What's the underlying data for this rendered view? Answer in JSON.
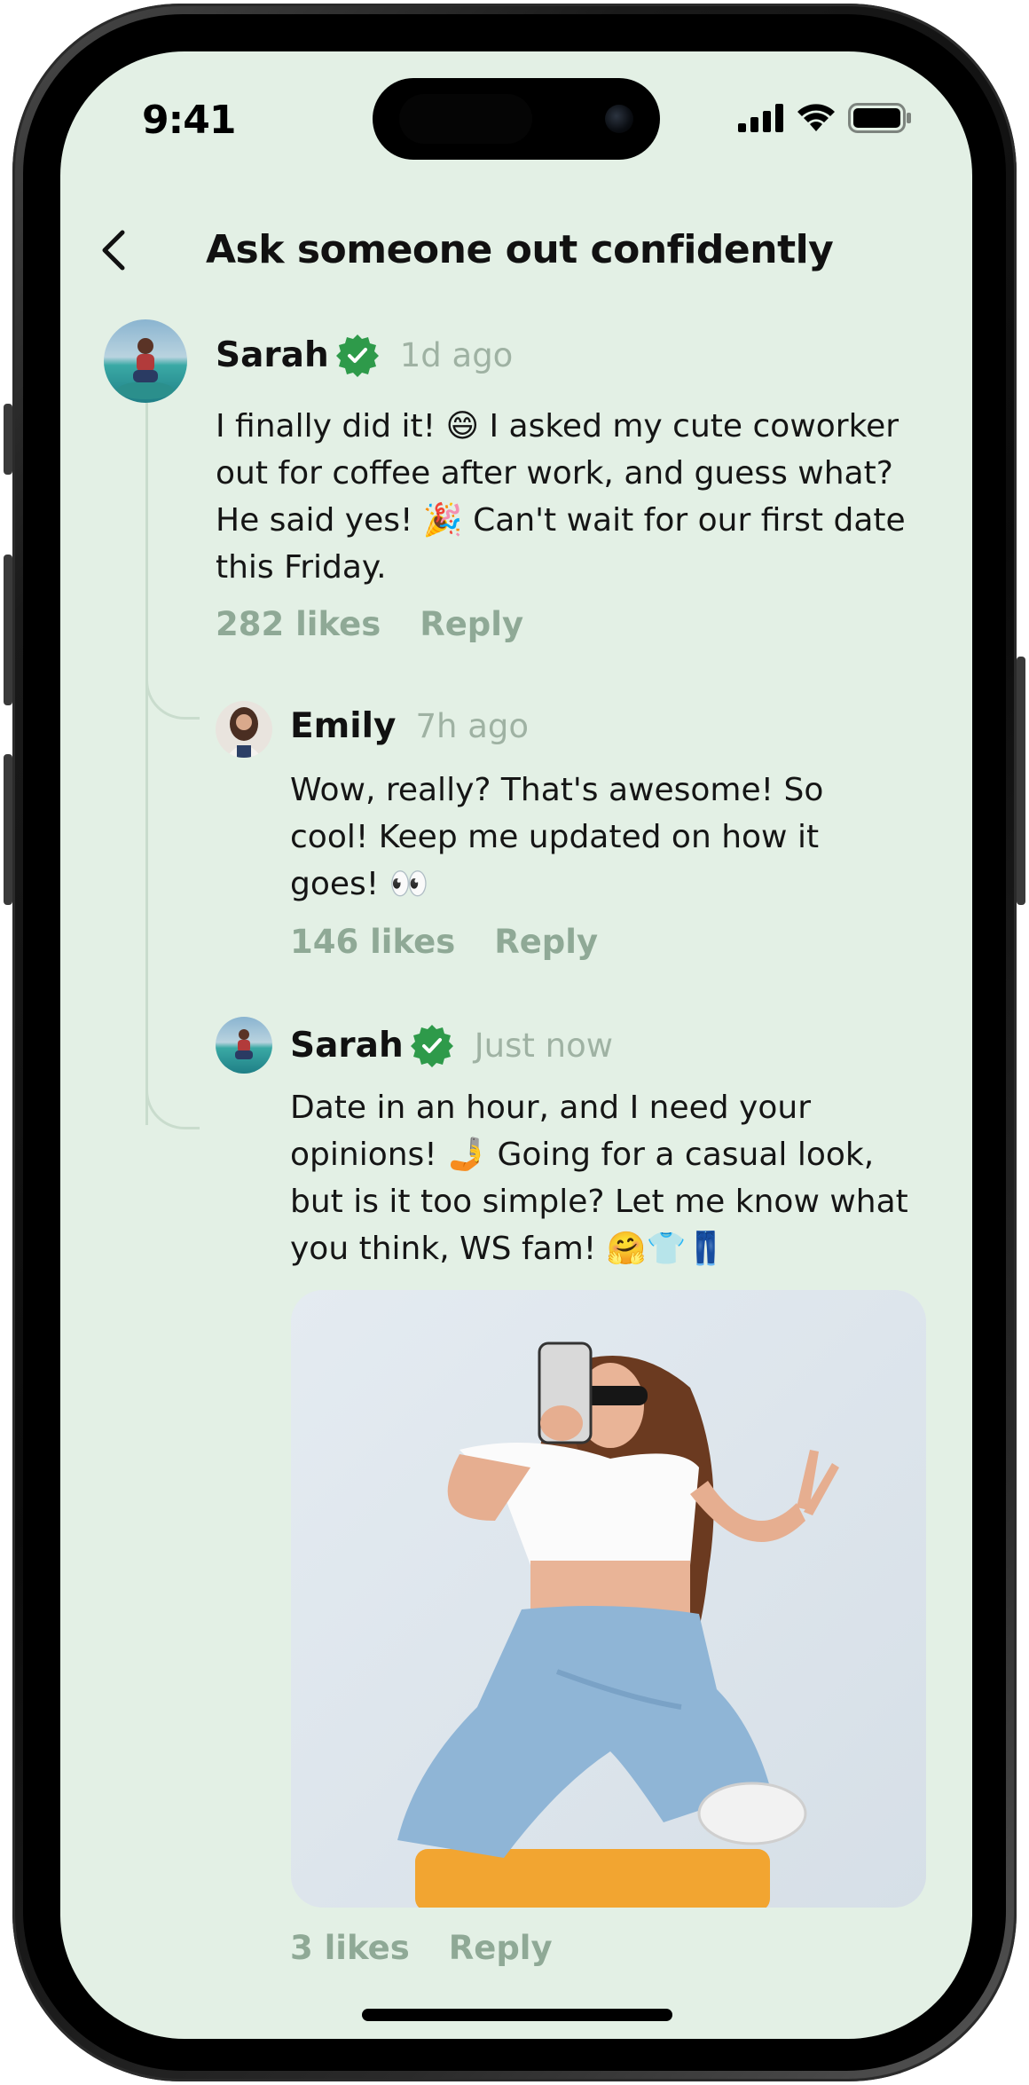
{
  "status_bar": {
    "time": "9:41"
  },
  "header": {
    "title": "Ask someone out confidently",
    "back_icon": "chevron-left-icon"
  },
  "comments": [
    {
      "author": "Sarah",
      "verified": true,
      "time_ago": "1d ago",
      "text": "I finally did it! 😄 I asked my cute coworker out for coffee after work, and guess what? He said yes! 🎉 Can't wait for our first date this Friday.",
      "likes": "282 likes",
      "reply": "Reply"
    },
    {
      "author": "Emily",
      "verified": false,
      "time_ago": "7h ago",
      "text": "Wow, really? That's awesome! So cool! Keep me updated on how it goes! 👀",
      "likes": "146 likes",
      "reply": "Reply"
    },
    {
      "author": "Sarah",
      "verified": true,
      "time_ago": "Just now",
      "text": "Date in an hour, and I need your opinions! 🤳 Going for a casual look, but is it too simple? Let me know what you think, WS fam! 🤗👕👖",
      "likes": "3 likes",
      "reply": "Reply"
    }
  ],
  "colors": {
    "background": "#e3f0e5",
    "muted_text": "#9fb2a3",
    "action_text": "#8fa996",
    "verified_badge": "#2e9a4a"
  }
}
